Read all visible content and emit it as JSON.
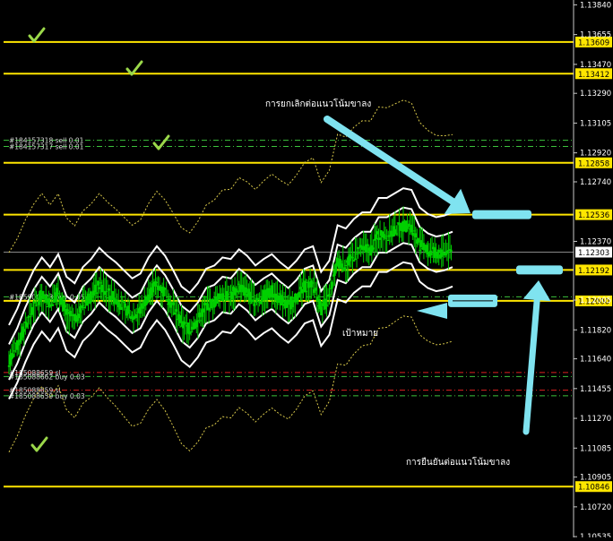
{
  "chart_data": {
    "type": "line",
    "colors": {
      "background": "#000000",
      "candle": "#00d000",
      "level": "#ffe600",
      "band": "#ffffff",
      "annotation": "#7fe3f0",
      "checkmark": "#9bd84a"
    },
    "y_axis": {
      "range": [
        1.1053,
        1.1387
      ],
      "ticks": [
        "1.13840",
        "1.13655",
        "1.13470",
        "1.13290",
        "1.13105",
        "1.12920",
        "1.12740",
        "1.12370",
        "1.12005",
        "1.11820",
        "1.11640",
        "1.11455",
        "1.11270",
        "1.11085",
        "1.10905",
        "1.10720",
        "1.10535"
      ]
    },
    "levels": [
      {
        "label": "1.13609",
        "value": 1.13609
      },
      {
        "label": "1.13412",
        "value": 1.13412
      },
      {
        "label": "1.12858",
        "value": 1.12858
      },
      {
        "label": "1.12536",
        "value": 1.12536
      },
      {
        "label": "1.12192",
        "value": 1.12192
      },
      {
        "label": "1.12000",
        "value": 1.12
      },
      {
        "label": "1.10846",
        "value": 1.10846
      }
    ],
    "current_price": {
      "label": "1.12303",
      "value": 1.12303
    },
    "orders": [
      {
        "label": "#184157318 sell 0.01",
        "value": 1.12998
      },
      {
        "label": "#184157317 sell 0.01",
        "value": 1.1296
      },
      {
        "label": "#185900423 buy 0.05",
        "value": 1.12025
      },
      {
        "label": "#185088659 sl",
        "value": 1.11555
      },
      {
        "label": "#185088662 buy 0.03",
        "value": 1.1153
      },
      {
        "label": "#185088659 sl",
        "value": 1.11445
      },
      {
        "label": "#185088659 buy 0.03",
        "value": 1.1141
      }
    ],
    "close_series": [
      1.1162,
      1.1172,
      1.1185,
      1.1196,
      1.1204,
      1.1198,
      1.1206,
      1.1192,
      1.1188,
      1.1198,
      1.1203,
      1.121,
      1.1205,
      1.1201,
      1.1196,
      1.1191,
      1.1194,
      1.1204,
      1.1211,
      1.1205,
      1.1196,
      1.1186,
      1.1182,
      1.1188,
      1.1197,
      1.1199,
      1.1204,
      1.1203,
      1.1209,
      1.1205,
      1.1199,
      1.1203,
      1.1206,
      1.1201,
      1.1197,
      1.1202,
      1.1209,
      1.1211,
      1.1195,
      1.1202,
      1.1224,
      1.1222,
      1.1228,
      1.1232,
      1.1232,
      1.1241,
      1.1241,
      1.1244,
      1.1247,
      1.1246,
      1.1235,
      1.1231,
      1.1229,
      1.123,
      1.1232
    ],
    "annotations": {
      "cancel_downtrend": "การยกเลิกต่อแนวโน้มขาลง",
      "target": "เป้าหมาย",
      "confirm_downtrend": "การยืนยันต่อแนวโน้มขาลง"
    }
  }
}
